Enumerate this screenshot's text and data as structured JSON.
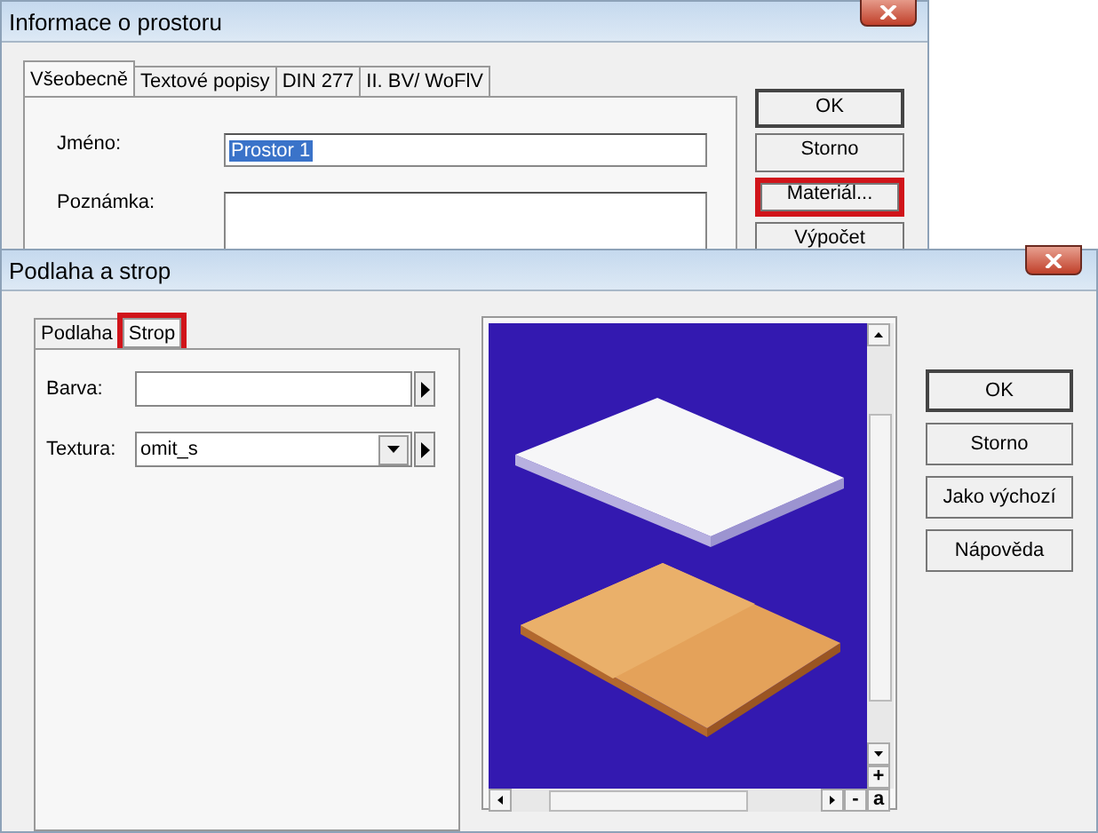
{
  "back_window": {
    "title": "Informace o prostoru",
    "tabs": [
      {
        "label": "Všeobecně",
        "selected": true
      },
      {
        "label": "Textové popisy",
        "selected": false
      },
      {
        "label": "DIN 277",
        "selected": false
      },
      {
        "label": "II. BV/ WoFlV",
        "selected": false
      }
    ],
    "fields": [
      {
        "label": "Jméno:",
        "value": "Prostor 1",
        "text_selected": true,
        "kind": "line"
      },
      {
        "label": "Poznámka:",
        "kind": "area"
      }
    ],
    "buttons": [
      {
        "label": "OK",
        "default": true,
        "highlighted": false
      },
      {
        "label": "Storno",
        "default": false,
        "highlighted": false
      },
      {
        "label": "Materiál...",
        "default": false,
        "highlighted": true
      },
      {
        "label": "Výpočet",
        "default": false,
        "highlighted": false
      }
    ]
  },
  "front_window": {
    "title": "Podlaha a strop",
    "tabs": [
      {
        "label": "Podlaha",
        "selected": false,
        "highlighted": false
      },
      {
        "label": "Strop",
        "selected": true,
        "highlighted": true
      }
    ],
    "fields": [
      {
        "label": "Barva:",
        "kind": "text"
      },
      {
        "label": "Textura:",
        "value": "omit_s",
        "kind": "combo"
      }
    ],
    "preview": {
      "kind": "picture",
      "scroll_buttons": [
        "+",
        "-",
        "a"
      ]
    },
    "buttons": [
      {
        "label": "OK",
        "default": true
      },
      {
        "label": "Storno",
        "default": false
      },
      {
        "label": "Jako výchozí",
        "default": false
      },
      {
        "label": "Nápověda",
        "default": false
      }
    ]
  }
}
